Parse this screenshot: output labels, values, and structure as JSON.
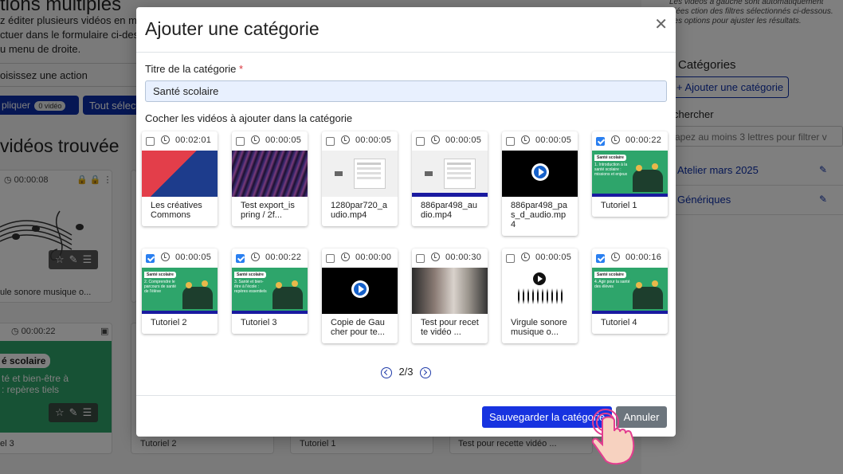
{
  "background": {
    "title": "tions multiples",
    "intro_lines": [
      "z éditer plusieurs vidéos en m",
      "ctuer dans le formulaire ci-des",
      "u menu de droite."
    ],
    "action_label": "oisissez une action",
    "apply_label": "pliquer",
    "apply_count": "0 vidéo",
    "select_all_label": "Tout sélect",
    "found_heading": "vidéos trouvée",
    "card1_duration": "00:00:08",
    "card1_caption": "ule sonore musique o...",
    "card2_duration": "00:00:22",
    "card2_badge": "é scolaire",
    "card2_text": "té et bien-être à : repères tiels",
    "card2_caption": "el 3",
    "bottom_captions": [
      "Tutoriel 2",
      "Tutoriel 1",
      "Test pour recette vidéo ..."
    ],
    "right_help": "Les vidéos à gauche sont automatiquement triées ction des filtres sélectionnés ci-dessous. Les options pour ajuster les résultats.",
    "categories_title": "Catégories",
    "add_category_label": "+ Ajouter une catégorie",
    "search_label": "chercher",
    "search_placeholder": "apez au moins 3 lettres pour filtrer v",
    "categories": [
      "Atelier mars 2025",
      "Génériques"
    ]
  },
  "modal": {
    "title": "Ajouter une catégorie",
    "field_label": "Titre de la catégorie",
    "required_mark": "*",
    "title_value": "Santé scolaire",
    "check_label": "Cocher les vidéos à ajouter dans la catégorie",
    "videos": [
      {
        "duration": "00:02:01",
        "name": "Les créatives Commons",
        "checked": false,
        "thumb": "red"
      },
      {
        "duration": "00:00:05",
        "name": "Test export_ispring / 2f...",
        "checked": false,
        "thumb": "stripes"
      },
      {
        "duration": "00:00:05",
        "name": "1280par720_audio.mp4",
        "checked": false,
        "thumb": "shot"
      },
      {
        "duration": "00:00:05",
        "name": "886par498_audio.mp4",
        "checked": false,
        "thumb": "shot-blue"
      },
      {
        "duration": "00:00:05",
        "name": "886par498_pas_d_audio.mp4",
        "checked": false,
        "thumb": "black"
      },
      {
        "duration": "00:00:22",
        "name": "Tutoriel 1",
        "checked": true,
        "thumb": "green"
      },
      {
        "duration": "00:00:05",
        "name": "Tutoriel 2",
        "checked": true,
        "thumb": "green"
      },
      {
        "duration": "00:00:22",
        "name": "Tutoriel 3",
        "checked": true,
        "thumb": "green"
      },
      {
        "duration": "00:00:00",
        "name": "Copie de Gaucher pour te...",
        "checked": false,
        "thumb": "black"
      },
      {
        "duration": "00:00:30",
        "name": "Test pour recette vidéo ...",
        "checked": false,
        "thumb": "photo"
      },
      {
        "duration": "00:00:05",
        "name": "Virgule sonore musique o...",
        "checked": false,
        "thumb": "wave"
      },
      {
        "duration": "00:00:16",
        "name": "Tutoriel 4",
        "checked": true,
        "thumb": "green"
      }
    ],
    "green_texts": [
      "1. Introduction à la santé scolaire : missions et enjeux",
      "2. Comprendre le parcours de santé de l'élève",
      "3. Santé et bien-être à l'école : repères essentiels",
      "4. Agir pour la santé des élèves"
    ],
    "green_badge": "Santé scolaire",
    "pager": "2/3",
    "save_label": "Sauvegarder la catégorie",
    "cancel_label": "Annuler"
  },
  "colors": {
    "primary": "#1733e0",
    "checkbox": "#2a7ff0",
    "green_thumb": "#2ea56b",
    "secondary": "#6c757d"
  }
}
